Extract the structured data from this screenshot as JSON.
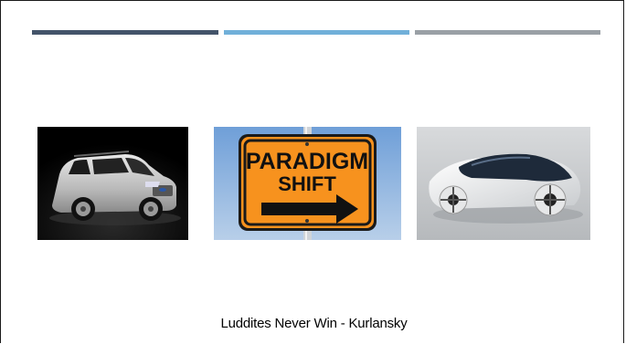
{
  "slide": {
    "accent_colors": [
      "#44546a",
      "#71b0d9",
      "#9aa0a6"
    ],
    "images": [
      {
        "name": "suv-photo",
        "icon": "suv-car-image"
      },
      {
        "name": "paradigm-shift-sign",
        "icon": "road-sign-image",
        "line1": "PARADIGM",
        "line2": "SHIFT"
      },
      {
        "name": "concept-car-photo",
        "icon": "concept-car-image"
      }
    ],
    "caption": "Luddites Never Win - Kurlansky"
  }
}
